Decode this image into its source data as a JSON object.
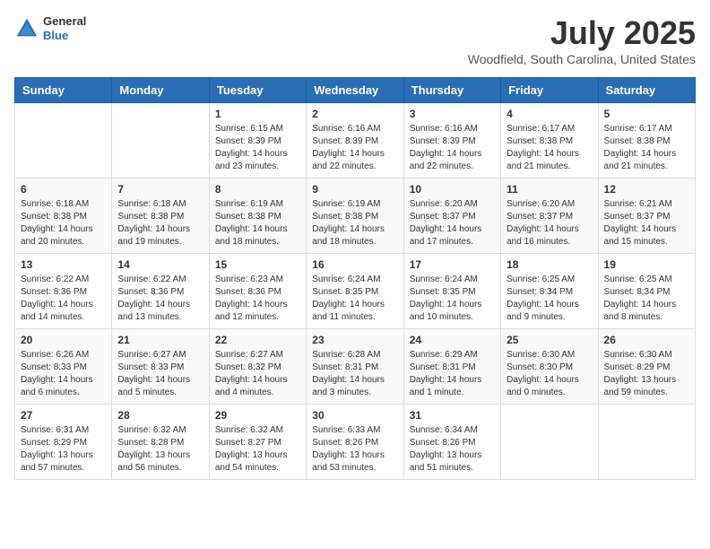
{
  "header": {
    "logo_general": "General",
    "logo_blue": "Blue",
    "month": "July 2025",
    "location": "Woodfield, South Carolina, United States"
  },
  "days_of_week": [
    "Sunday",
    "Monday",
    "Tuesday",
    "Wednesday",
    "Thursday",
    "Friday",
    "Saturday"
  ],
  "weeks": [
    [
      {
        "day": "",
        "info": ""
      },
      {
        "day": "",
        "info": ""
      },
      {
        "day": "1",
        "info": "Sunrise: 6:15 AM\nSunset: 8:39 PM\nDaylight: 14 hours and 23 minutes."
      },
      {
        "day": "2",
        "info": "Sunrise: 6:16 AM\nSunset: 8:39 PM\nDaylight: 14 hours and 22 minutes."
      },
      {
        "day": "3",
        "info": "Sunrise: 6:16 AM\nSunset: 8:39 PM\nDaylight: 14 hours and 22 minutes."
      },
      {
        "day": "4",
        "info": "Sunrise: 6:17 AM\nSunset: 8:38 PM\nDaylight: 14 hours and 21 minutes."
      },
      {
        "day": "5",
        "info": "Sunrise: 6:17 AM\nSunset: 8:38 PM\nDaylight: 14 hours and 21 minutes."
      }
    ],
    [
      {
        "day": "6",
        "info": "Sunrise: 6:18 AM\nSunset: 8:38 PM\nDaylight: 14 hours and 20 minutes."
      },
      {
        "day": "7",
        "info": "Sunrise: 6:18 AM\nSunset: 8:38 PM\nDaylight: 14 hours and 19 minutes."
      },
      {
        "day": "8",
        "info": "Sunrise: 6:19 AM\nSunset: 8:38 PM\nDaylight: 14 hours and 18 minutes."
      },
      {
        "day": "9",
        "info": "Sunrise: 6:19 AM\nSunset: 8:38 PM\nDaylight: 14 hours and 18 minutes."
      },
      {
        "day": "10",
        "info": "Sunrise: 6:20 AM\nSunset: 8:37 PM\nDaylight: 14 hours and 17 minutes."
      },
      {
        "day": "11",
        "info": "Sunrise: 6:20 AM\nSunset: 8:37 PM\nDaylight: 14 hours and 16 minutes."
      },
      {
        "day": "12",
        "info": "Sunrise: 6:21 AM\nSunset: 8:37 PM\nDaylight: 14 hours and 15 minutes."
      }
    ],
    [
      {
        "day": "13",
        "info": "Sunrise: 6:22 AM\nSunset: 8:36 PM\nDaylight: 14 hours and 14 minutes."
      },
      {
        "day": "14",
        "info": "Sunrise: 6:22 AM\nSunset: 8:36 PM\nDaylight: 14 hours and 13 minutes."
      },
      {
        "day": "15",
        "info": "Sunrise: 6:23 AM\nSunset: 8:36 PM\nDaylight: 14 hours and 12 minutes."
      },
      {
        "day": "16",
        "info": "Sunrise: 6:24 AM\nSunset: 8:35 PM\nDaylight: 14 hours and 11 minutes."
      },
      {
        "day": "17",
        "info": "Sunrise: 6:24 AM\nSunset: 8:35 PM\nDaylight: 14 hours and 10 minutes."
      },
      {
        "day": "18",
        "info": "Sunrise: 6:25 AM\nSunset: 8:34 PM\nDaylight: 14 hours and 9 minutes."
      },
      {
        "day": "19",
        "info": "Sunrise: 6:25 AM\nSunset: 8:34 PM\nDaylight: 14 hours and 8 minutes."
      }
    ],
    [
      {
        "day": "20",
        "info": "Sunrise: 6:26 AM\nSunset: 8:33 PM\nDaylight: 14 hours and 6 minutes."
      },
      {
        "day": "21",
        "info": "Sunrise: 6:27 AM\nSunset: 8:33 PM\nDaylight: 14 hours and 5 minutes."
      },
      {
        "day": "22",
        "info": "Sunrise: 6:27 AM\nSunset: 8:32 PM\nDaylight: 14 hours and 4 minutes."
      },
      {
        "day": "23",
        "info": "Sunrise: 6:28 AM\nSunset: 8:31 PM\nDaylight: 14 hours and 3 minutes."
      },
      {
        "day": "24",
        "info": "Sunrise: 6:29 AM\nSunset: 8:31 PM\nDaylight: 14 hours and 1 minute."
      },
      {
        "day": "25",
        "info": "Sunrise: 6:30 AM\nSunset: 8:30 PM\nDaylight: 14 hours and 0 minutes."
      },
      {
        "day": "26",
        "info": "Sunrise: 6:30 AM\nSunset: 8:29 PM\nDaylight: 13 hours and 59 minutes."
      }
    ],
    [
      {
        "day": "27",
        "info": "Sunrise: 6:31 AM\nSunset: 8:29 PM\nDaylight: 13 hours and 57 minutes."
      },
      {
        "day": "28",
        "info": "Sunrise: 6:32 AM\nSunset: 8:28 PM\nDaylight: 13 hours and 56 minutes."
      },
      {
        "day": "29",
        "info": "Sunrise: 6:32 AM\nSunset: 8:27 PM\nDaylight: 13 hours and 54 minutes."
      },
      {
        "day": "30",
        "info": "Sunrise: 6:33 AM\nSunset: 8:26 PM\nDaylight: 13 hours and 53 minutes."
      },
      {
        "day": "31",
        "info": "Sunrise: 6:34 AM\nSunset: 8:26 PM\nDaylight: 13 hours and 51 minutes."
      },
      {
        "day": "",
        "info": ""
      },
      {
        "day": "",
        "info": ""
      }
    ]
  ]
}
